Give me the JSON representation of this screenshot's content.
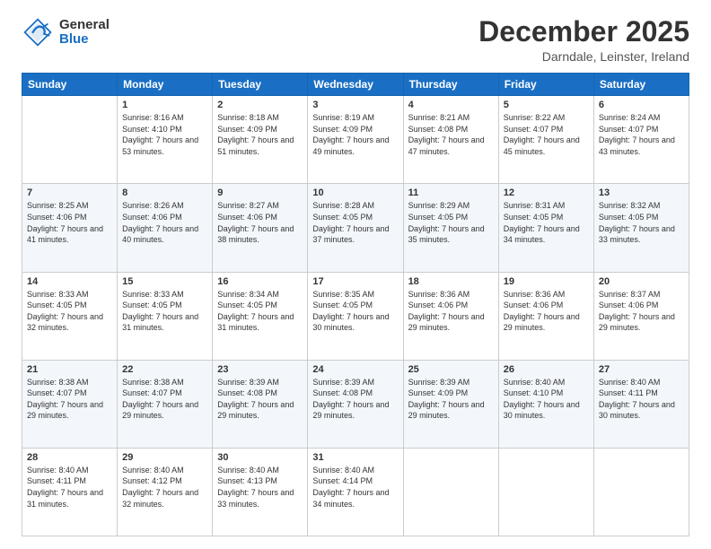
{
  "logo": {
    "general": "General",
    "blue": "Blue"
  },
  "title": "December 2025",
  "location": "Darndale, Leinster, Ireland",
  "days_of_week": [
    "Sunday",
    "Monday",
    "Tuesday",
    "Wednesday",
    "Thursday",
    "Friday",
    "Saturday"
  ],
  "weeks": [
    [
      {
        "day": "",
        "sunrise": "",
        "sunset": "",
        "daylight": "",
        "empty": true
      },
      {
        "day": "1",
        "sunrise": "Sunrise: 8:16 AM",
        "sunset": "Sunset: 4:10 PM",
        "daylight": "Daylight: 7 hours and 53 minutes."
      },
      {
        "day": "2",
        "sunrise": "Sunrise: 8:18 AM",
        "sunset": "Sunset: 4:09 PM",
        "daylight": "Daylight: 7 hours and 51 minutes."
      },
      {
        "day": "3",
        "sunrise": "Sunrise: 8:19 AM",
        "sunset": "Sunset: 4:09 PM",
        "daylight": "Daylight: 7 hours and 49 minutes."
      },
      {
        "day": "4",
        "sunrise": "Sunrise: 8:21 AM",
        "sunset": "Sunset: 4:08 PM",
        "daylight": "Daylight: 7 hours and 47 minutes."
      },
      {
        "day": "5",
        "sunrise": "Sunrise: 8:22 AM",
        "sunset": "Sunset: 4:07 PM",
        "daylight": "Daylight: 7 hours and 45 minutes."
      },
      {
        "day": "6",
        "sunrise": "Sunrise: 8:24 AM",
        "sunset": "Sunset: 4:07 PM",
        "daylight": "Daylight: 7 hours and 43 minutes."
      }
    ],
    [
      {
        "day": "7",
        "sunrise": "Sunrise: 8:25 AM",
        "sunset": "Sunset: 4:06 PM",
        "daylight": "Daylight: 7 hours and 41 minutes."
      },
      {
        "day": "8",
        "sunrise": "Sunrise: 8:26 AM",
        "sunset": "Sunset: 4:06 PM",
        "daylight": "Daylight: 7 hours and 40 minutes."
      },
      {
        "day": "9",
        "sunrise": "Sunrise: 8:27 AM",
        "sunset": "Sunset: 4:06 PM",
        "daylight": "Daylight: 7 hours and 38 minutes."
      },
      {
        "day": "10",
        "sunrise": "Sunrise: 8:28 AM",
        "sunset": "Sunset: 4:05 PM",
        "daylight": "Daylight: 7 hours and 37 minutes."
      },
      {
        "day": "11",
        "sunrise": "Sunrise: 8:29 AM",
        "sunset": "Sunset: 4:05 PM",
        "daylight": "Daylight: 7 hours and 35 minutes."
      },
      {
        "day": "12",
        "sunrise": "Sunrise: 8:31 AM",
        "sunset": "Sunset: 4:05 PM",
        "daylight": "Daylight: 7 hours and 34 minutes."
      },
      {
        "day": "13",
        "sunrise": "Sunrise: 8:32 AM",
        "sunset": "Sunset: 4:05 PM",
        "daylight": "Daylight: 7 hours and 33 minutes."
      }
    ],
    [
      {
        "day": "14",
        "sunrise": "Sunrise: 8:33 AM",
        "sunset": "Sunset: 4:05 PM",
        "daylight": "Daylight: 7 hours and 32 minutes."
      },
      {
        "day": "15",
        "sunrise": "Sunrise: 8:33 AM",
        "sunset": "Sunset: 4:05 PM",
        "daylight": "Daylight: 7 hours and 31 minutes."
      },
      {
        "day": "16",
        "sunrise": "Sunrise: 8:34 AM",
        "sunset": "Sunset: 4:05 PM",
        "daylight": "Daylight: 7 hours and 31 minutes."
      },
      {
        "day": "17",
        "sunrise": "Sunrise: 8:35 AM",
        "sunset": "Sunset: 4:05 PM",
        "daylight": "Daylight: 7 hours and 30 minutes."
      },
      {
        "day": "18",
        "sunrise": "Sunrise: 8:36 AM",
        "sunset": "Sunset: 4:06 PM",
        "daylight": "Daylight: 7 hours and 29 minutes."
      },
      {
        "day": "19",
        "sunrise": "Sunrise: 8:36 AM",
        "sunset": "Sunset: 4:06 PM",
        "daylight": "Daylight: 7 hours and 29 minutes."
      },
      {
        "day": "20",
        "sunrise": "Sunrise: 8:37 AM",
        "sunset": "Sunset: 4:06 PM",
        "daylight": "Daylight: 7 hours and 29 minutes."
      }
    ],
    [
      {
        "day": "21",
        "sunrise": "Sunrise: 8:38 AM",
        "sunset": "Sunset: 4:07 PM",
        "daylight": "Daylight: 7 hours and 29 minutes."
      },
      {
        "day": "22",
        "sunrise": "Sunrise: 8:38 AM",
        "sunset": "Sunset: 4:07 PM",
        "daylight": "Daylight: 7 hours and 29 minutes."
      },
      {
        "day": "23",
        "sunrise": "Sunrise: 8:39 AM",
        "sunset": "Sunset: 4:08 PM",
        "daylight": "Daylight: 7 hours and 29 minutes."
      },
      {
        "day": "24",
        "sunrise": "Sunrise: 8:39 AM",
        "sunset": "Sunset: 4:08 PM",
        "daylight": "Daylight: 7 hours and 29 minutes."
      },
      {
        "day": "25",
        "sunrise": "Sunrise: 8:39 AM",
        "sunset": "Sunset: 4:09 PM",
        "daylight": "Daylight: 7 hours and 29 minutes."
      },
      {
        "day": "26",
        "sunrise": "Sunrise: 8:40 AM",
        "sunset": "Sunset: 4:10 PM",
        "daylight": "Daylight: 7 hours and 30 minutes."
      },
      {
        "day": "27",
        "sunrise": "Sunrise: 8:40 AM",
        "sunset": "Sunset: 4:11 PM",
        "daylight": "Daylight: 7 hours and 30 minutes."
      }
    ],
    [
      {
        "day": "28",
        "sunrise": "Sunrise: 8:40 AM",
        "sunset": "Sunset: 4:11 PM",
        "daylight": "Daylight: 7 hours and 31 minutes."
      },
      {
        "day": "29",
        "sunrise": "Sunrise: 8:40 AM",
        "sunset": "Sunset: 4:12 PM",
        "daylight": "Daylight: 7 hours and 32 minutes."
      },
      {
        "day": "30",
        "sunrise": "Sunrise: 8:40 AM",
        "sunset": "Sunset: 4:13 PM",
        "daylight": "Daylight: 7 hours and 33 minutes."
      },
      {
        "day": "31",
        "sunrise": "Sunrise: 8:40 AM",
        "sunset": "Sunset: 4:14 PM",
        "daylight": "Daylight: 7 hours and 34 minutes."
      },
      {
        "day": "",
        "sunrise": "",
        "sunset": "",
        "daylight": "",
        "empty": true
      },
      {
        "day": "",
        "sunrise": "",
        "sunset": "",
        "daylight": "",
        "empty": true
      },
      {
        "day": "",
        "sunrise": "",
        "sunset": "",
        "daylight": "",
        "empty": true
      }
    ]
  ]
}
